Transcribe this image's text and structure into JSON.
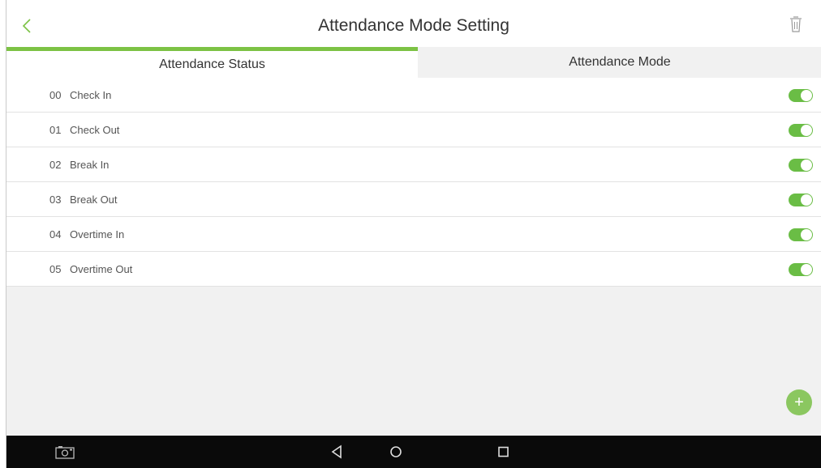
{
  "header": {
    "title": "Attendance Mode Setting",
    "back_icon": "chevron-left-icon",
    "delete_icon": "trash-icon"
  },
  "tabs": [
    {
      "label": "Attendance Status",
      "active": true
    },
    {
      "label": "Attendance Mode",
      "active": false
    }
  ],
  "statuses": [
    {
      "code": "00",
      "name": "Check In",
      "enabled": true
    },
    {
      "code": "01",
      "name": "Check Out",
      "enabled": true
    },
    {
      "code": "02",
      "name": "Break In",
      "enabled": true
    },
    {
      "code": "03",
      "name": "Break Out",
      "enabled": true
    },
    {
      "code": "04",
      "name": "Overtime In",
      "enabled": true
    },
    {
      "code": "05",
      "name": "Overtime Out",
      "enabled": true
    }
  ],
  "fab": {
    "label": "+",
    "icon": "plus-icon"
  },
  "navbar": {
    "items": [
      "camera-icon",
      "back-triangle-icon",
      "home-circle-icon",
      "recents-square-icon"
    ]
  },
  "colors": {
    "accent": "#7cc244",
    "toggle_on": "#6abd45",
    "fab": "#8bc760",
    "navbar": "#0a0a0a"
  }
}
